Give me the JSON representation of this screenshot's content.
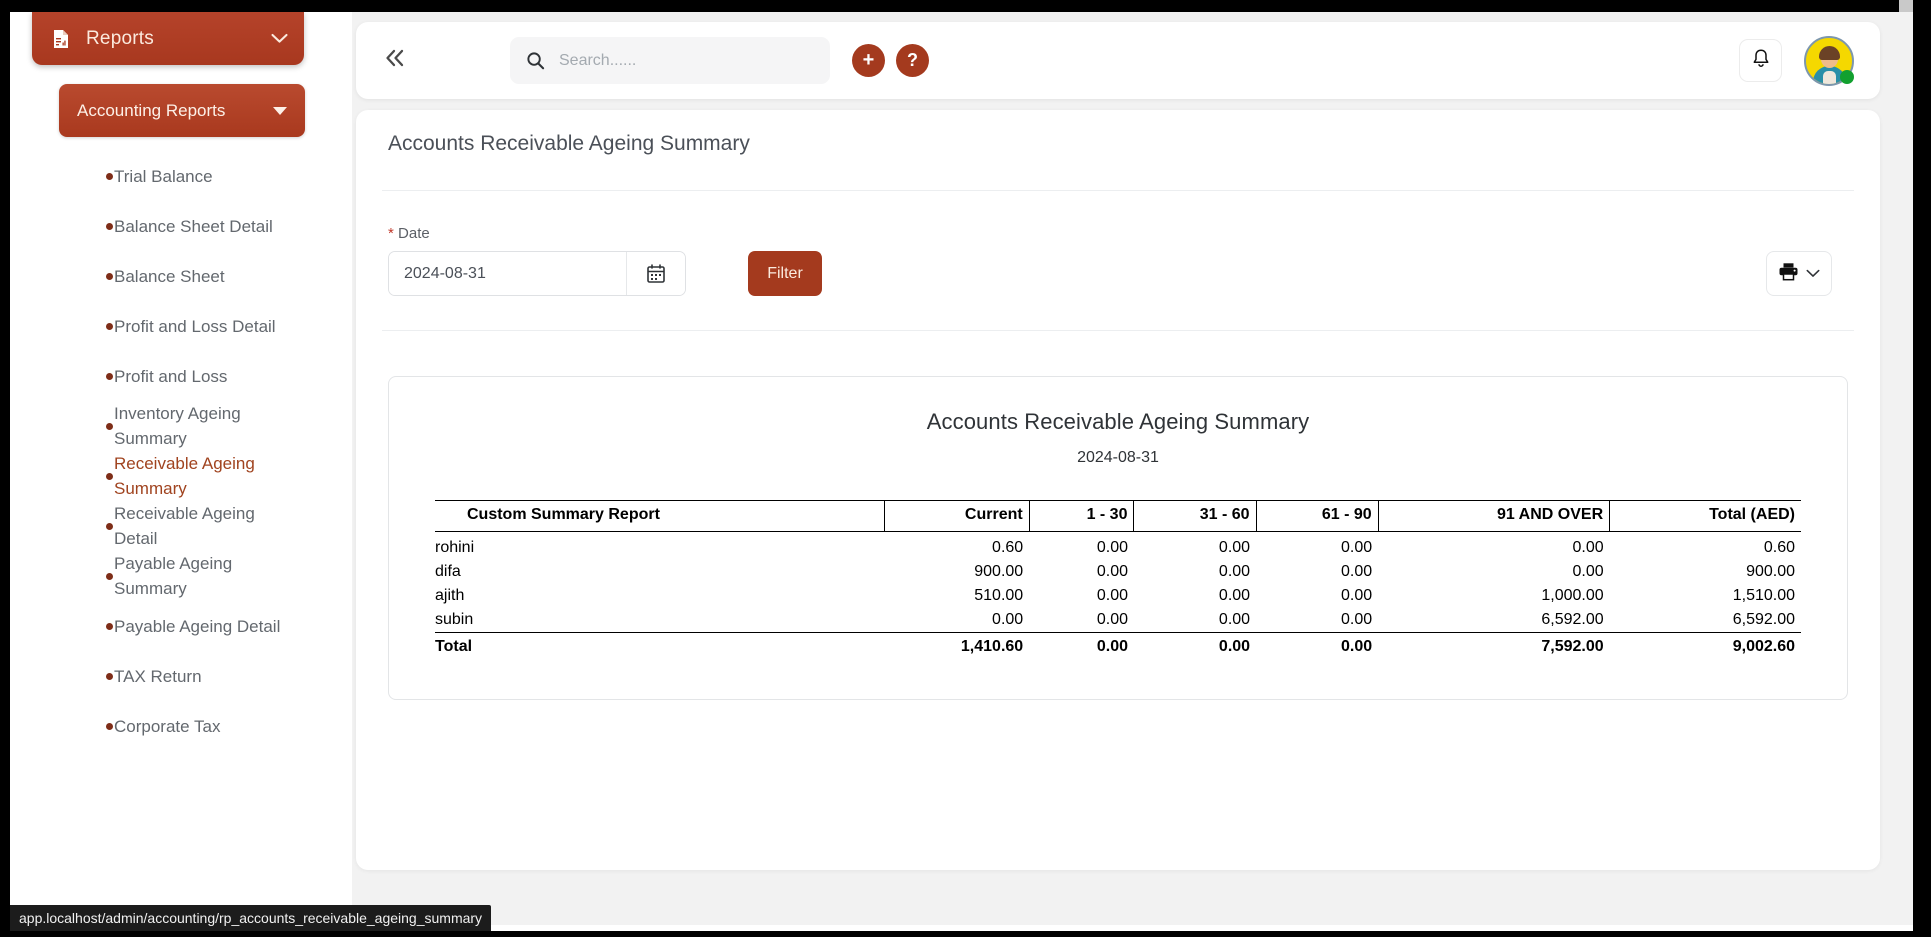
{
  "sidebar": {
    "header": {
      "title": "Reports",
      "icon": "report-document-icon",
      "chevron": "chevron-down-icon"
    },
    "group": {
      "title": "Accounting Reports",
      "caret": "caret-down-icon"
    },
    "items": [
      {
        "label": "Trial Balance",
        "active": false
      },
      {
        "label": "Balance Sheet Detail",
        "active": false
      },
      {
        "label": "Balance Sheet",
        "active": false
      },
      {
        "label": "Profit and Loss Detail",
        "active": false
      },
      {
        "label": "Profit and Loss",
        "active": false
      },
      {
        "label": "Inventory Ageing Summary",
        "active": false
      },
      {
        "label": "Receivable Ageing Summary",
        "active": true
      },
      {
        "label": "Receivable Ageing Detail",
        "active": false
      },
      {
        "label": "Payable Ageing Summary",
        "active": false
      },
      {
        "label": "Payable Ageing Detail",
        "active": false
      },
      {
        "label": "TAX Return",
        "active": false
      },
      {
        "label": "Corporate Tax",
        "active": false
      }
    ]
  },
  "topbar": {
    "collapse_icon": "double-chevron-left-icon",
    "search_placeholder": "Search......",
    "search_value": "",
    "add_label": "+",
    "help_label": "?",
    "bell_icon": "bell-icon",
    "avatar_icon": "user-avatar"
  },
  "page": {
    "title": "Accounts Receivable Ageing Summary"
  },
  "filter": {
    "date_label": "Date",
    "required_mark": "*",
    "date_value": "2024-08-31",
    "calendar_icon": "calendar-icon",
    "filter_label": "Filter",
    "print_icon": "printer-icon",
    "print_chevron": "chevron-down-icon"
  },
  "report": {
    "title": "Accounts Receivable Ageing Summary",
    "date": "2024-08-31",
    "columns": [
      "Custom Summary Report",
      "Current",
      "1 - 30",
      "31 - 60",
      "61 - 90",
      "91 AND OVER",
      "Total (AED)"
    ],
    "rows": [
      {
        "name": "rohini",
        "values": [
          "0.60",
          "0.00",
          "0.00",
          "0.00",
          "0.00",
          "0.60"
        ]
      },
      {
        "name": "difa",
        "values": [
          "900.00",
          "0.00",
          "0.00",
          "0.00",
          "0.00",
          "900.00"
        ]
      },
      {
        "name": "ajith",
        "values": [
          "510.00",
          "0.00",
          "0.00",
          "0.00",
          "1,000.00",
          "1,510.00"
        ]
      },
      {
        "name": "subin",
        "values": [
          "0.00",
          "0.00",
          "0.00",
          "0.00",
          "6,592.00",
          "6,592.00"
        ]
      }
    ],
    "total": {
      "name": "Total",
      "values": [
        "1,410.60",
        "0.00",
        "0.00",
        "0.00",
        "7,592.00",
        "9,002.60"
      ]
    }
  },
  "status_bar": {
    "url": "app.localhost/admin/accounting/rp_accounts_receivable_ageing_summary"
  },
  "colors": {
    "brand": "#a43a1e",
    "brand_dark": "#7e2d18",
    "active_text": "#a0431f",
    "status_online": "#12a02f",
    "avatar_bg": "#f5d800"
  }
}
